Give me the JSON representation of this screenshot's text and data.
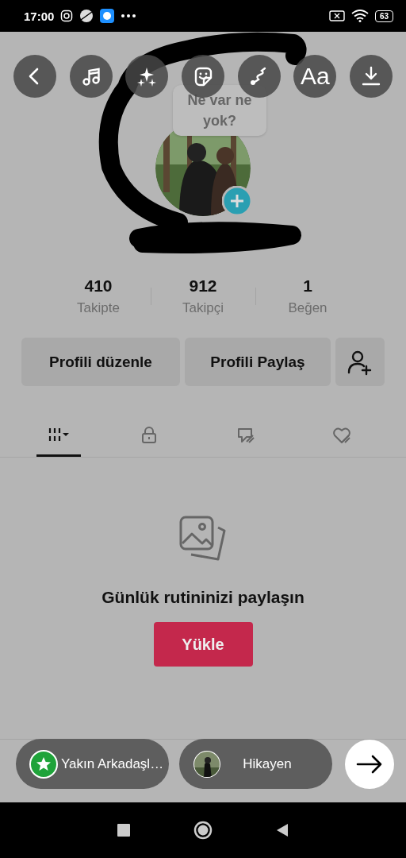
{
  "status_bar": {
    "time": "17:00",
    "battery": "63"
  },
  "toolbar": [
    {
      "kind": "back"
    },
    {
      "kind": "music"
    },
    {
      "kind": "effects"
    },
    {
      "kind": "sticker"
    },
    {
      "kind": "draw"
    },
    {
      "kind": "text",
      "label": "Aa"
    },
    {
      "kind": "download"
    }
  ],
  "profile": {
    "bubble": "Ne var ne yok?",
    "stats": [
      {
        "value": "410",
        "label": "Takipte"
      },
      {
        "value": "912",
        "label": "Takipçi"
      },
      {
        "value": "1",
        "label": "Beğen"
      }
    ],
    "buttons": [
      "Profili düzenle",
      "Profili Paylaş"
    ]
  },
  "tabs": [
    {
      "kind": "grid",
      "selected": true
    },
    {
      "kind": "lock",
      "selected": false
    },
    {
      "kind": "tagged",
      "selected": false
    },
    {
      "kind": "liked",
      "selected": false
    }
  ],
  "empty_state": {
    "title": "Günlük rutininizi paylaşın",
    "button": "Yükle"
  },
  "share": [
    {
      "kind": "close_friends",
      "label": "Yakın Arkadaşl…"
    },
    {
      "kind": "story",
      "label": "Hikayen"
    }
  ]
}
